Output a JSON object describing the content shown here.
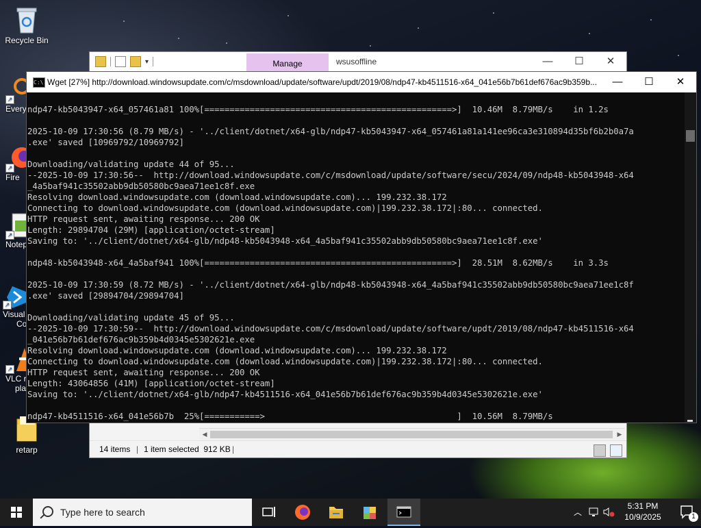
{
  "desktop": {
    "icons": [
      {
        "label": "Recycle Bin"
      },
      {
        "label": "Every"
      },
      {
        "label": "Fire"
      },
      {
        "label": "Notep"
      },
      {
        "label": "Visual",
        "label2": "Co"
      },
      {
        "label": "VLC r",
        "label2": "pla"
      },
      {
        "label": "retarp"
      }
    ]
  },
  "explorer": {
    "manage_tab": "Manage",
    "title": "wsusoffline",
    "status_items": "14 items",
    "status_selected": "1 item selected  912 KB"
  },
  "console": {
    "title": "Wget [27%] http://download.windowsupdate.com/c/msdownload/update/software/updt/2019/08/ndp47-kb4511516-x64_041e56b7b61def676ac9b359b...",
    "lines": [
      "ndp47-kb5043947-x64_057461a81 100%[=================================================>]  10.46M  8.79MB/s    in 1.2s",
      "",
      "2025-10-09 17:30:56 (8.79 MB/s) - '../client/dotnet/x64-glb/ndp47-kb5043947-x64_057461a81a141ee96ca3e310894d35bf6b2b0a7a",
      ".exe' saved [10969792/10969792]",
      "",
      "Downloading/validating update 44 of 95...",
      "--2025-10-09 17:30:56--  http://download.windowsupdate.com/c/msdownload/update/software/secu/2024/09/ndp48-kb5043948-x64",
      "_4a5baf941c35502abb9db50580bc9aea71ee1c8f.exe",
      "Resolving download.windowsupdate.com (download.windowsupdate.com)... 199.232.38.172",
      "Connecting to download.windowsupdate.com (download.windowsupdate.com)|199.232.38.172|:80... connected.",
      "HTTP request sent, awaiting response... 200 OK",
      "Length: 29894704 (29M) [application/octet-stream]",
      "Saving to: '../client/dotnet/x64-glb/ndp48-kb5043948-x64_4a5baf941c35502abb9db50580bc9aea71ee1c8f.exe'",
      "",
      "ndp48-kb5043948-x64_4a5baf941 100%[=================================================>]  28.51M  8.62MB/s    in 3.3s",
      "",
      "2025-10-09 17:30:59 (8.72 MB/s) - '../client/dotnet/x64-glb/ndp48-kb5043948-x64_4a5baf941c35502abb9db50580bc9aea71ee1c8f",
      ".exe' saved [29894704/29894704]",
      "",
      "Downloading/validating update 45 of 95...",
      "--2025-10-09 17:30:59--  http://download.windowsupdate.com/c/msdownload/update/software/updt/2019/08/ndp47-kb4511516-x64",
      "_041e56b7b61def676ac9b359b4d0345e5302621e.exe",
      "Resolving download.windowsupdate.com (download.windowsupdate.com)... 199.232.38.172",
      "Connecting to download.windowsupdate.com (download.windowsupdate.com)|199.232.38.172|:80... connected.",
      "HTTP request sent, awaiting response... 200 OK",
      "Length: 43064856 (41M) [application/octet-stream]",
      "Saving to: '../client/dotnet/x64-glb/ndp47-kb4511516-x64_041e56b7b61def676ac9b359b4d0345e5302621e.exe'",
      "",
      "ndp47-kb4511516-x64_041e56b7b  25%[===========>                                      ]  10.56M  8.79MB/s"
    ]
  },
  "taskbar": {
    "search_placeholder": "Type here to search",
    "time": "5:31 PM",
    "date": "10/9/2025",
    "notification_count": "1"
  },
  "colors": {
    "console_bg": "#0c0c0c",
    "console_text": "#cccccc",
    "manage_tab": "#e6c3ee",
    "taskbar": "#1e1e1e"
  }
}
